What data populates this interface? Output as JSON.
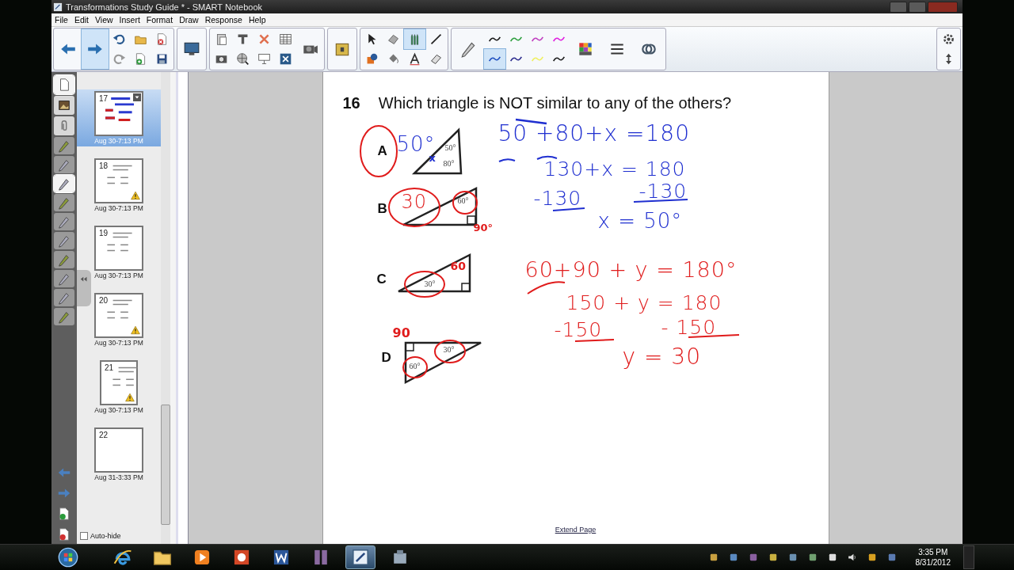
{
  "window": {
    "title": "Transformations Study Guide * - SMART Notebook"
  },
  "menu": [
    "File",
    "Edit",
    "View",
    "Insert",
    "Format",
    "Draw",
    "Response",
    "Help"
  ],
  "toolbar": {
    "groups": [
      {
        "buttons": [
          {
            "kind": "back",
            "selected": false
          },
          {
            "kind": "forward",
            "selected": true
          },
          {
            "kind": "undo",
            "selected": false
          },
          {
            "kind": "redo",
            "selected": false
          },
          {
            "kind": "folder",
            "selected": false
          },
          {
            "kind": "add-page",
            "selected": false
          },
          {
            "kind": "delete-page",
            "selected": false
          },
          {
            "kind": "save",
            "selected": false
          }
        ]
      },
      {
        "buttons": [
          {
            "kind": "monitor",
            "selected": false
          }
        ]
      },
      {
        "buttons": [
          {
            "kind": "clipboard",
            "selected": false
          },
          {
            "kind": "camera",
            "selected": false
          },
          {
            "kind": "shade",
            "selected": false
          },
          {
            "kind": "globe",
            "selected": false
          },
          {
            "kind": "delete",
            "selected": false
          },
          {
            "kind": "screen",
            "selected": false
          },
          {
            "kind": "table",
            "selected": false
          },
          {
            "kind": "xbox",
            "selected": false
          },
          {
            "kind": "projector",
            "selected": false
          }
        ]
      },
      {
        "buttons": [
          {
            "kind": "toolbox",
            "selected": false
          }
        ]
      },
      {
        "buttons": [
          {
            "kind": "select",
            "selected": false
          },
          {
            "kind": "shapes",
            "selected": false
          },
          {
            "kind": "eraser",
            "selected": false
          },
          {
            "kind": "fill",
            "selected": false
          },
          {
            "kind": "pens",
            "selected": true
          },
          {
            "kind": "text",
            "selected": false
          },
          {
            "kind": "line",
            "selected": false
          },
          {
            "kind": "eraser2",
            "selected": false
          }
        ]
      },
      {
        "buttons": [
          {
            "kind": "pen",
            "selected": false
          },
          {
            "kind": "stroke",
            "selected": false
          },
          {
            "kind": "stroke",
            "selected": true
          },
          {
            "kind": "stroke",
            "selected": false
          },
          {
            "kind": "stroke",
            "selected": false
          },
          {
            "kind": "stroke",
            "selected": false
          },
          {
            "kind": "stroke",
            "selected": false
          },
          {
            "kind": "stroke",
            "selected": false
          },
          {
            "kind": "stroke",
            "selected": false
          },
          {
            "kind": "palette",
            "selected": false
          },
          {
            "kind": "lines",
            "selected": false
          },
          {
            "kind": "link",
            "selected": false
          }
        ]
      },
      {
        "buttons": [
          {
            "kind": "gear",
            "selected": false
          },
          {
            "kind": "updown",
            "selected": false
          }
        ]
      }
    ]
  },
  "side_tabs": [
    {
      "kind": "pages",
      "selected": true
    },
    {
      "kind": "gallery",
      "selected": false
    },
    {
      "kind": "attachments",
      "selected": false
    },
    {
      "kind": "tool",
      "selected": false
    },
    {
      "kind": "tool",
      "selected": false
    },
    {
      "kind": "tool",
      "selected": true
    },
    {
      "kind": "tool",
      "selected": false
    },
    {
      "kind": "tool",
      "selected": false
    },
    {
      "kind": "tool",
      "selected": false
    },
    {
      "kind": "tool",
      "selected": false
    },
    {
      "kind": "tool",
      "selected": false
    },
    {
      "kind": "tool",
      "selected": false
    },
    {
      "kind": "tool",
      "selected": false
    }
  ],
  "pages": [
    {
      "number": "17",
      "date": "Aug 30-7:13 PM",
      "selected": true,
      "warning": false
    },
    {
      "number": "18",
      "date": "Aug 30-7:13 PM",
      "selected": false,
      "warning": true
    },
    {
      "number": "19",
      "date": "Aug 30-7:13 PM",
      "selected": false,
      "warning": false
    },
    {
      "number": "20",
      "date": "Aug 30-7:13 PM",
      "selected": false,
      "warning": true
    },
    {
      "number": "21",
      "date": "Aug 30-7:13 PM",
      "selected": false,
      "warning": true
    },
    {
      "number": "22",
      "date": "Aug 31-3:33 PM",
      "selected": false,
      "warning": false
    }
  ],
  "auto_hide": {
    "label": "Auto-hide",
    "checked": false
  },
  "page": {
    "question_number": "16",
    "question": "Which triangle is NOT similar to any of the others?",
    "triangles": [
      {
        "label": "A",
        "angles": [
          "50°",
          "80°"
        ]
      },
      {
        "label": "B",
        "angles": [
          "60°"
        ]
      },
      {
        "label": "C",
        "angles": [
          "30°"
        ]
      },
      {
        "label": "D",
        "angles": [
          "30°",
          "60°"
        ]
      }
    ],
    "ink": [
      {
        "text": "50°",
        "color": "#1f2fd0"
      },
      {
        "text": "x",
        "color": "#1f2fd0"
      },
      {
        "text": "50 +80+x =180",
        "color": "#1f2fd0"
      },
      {
        "text": "130+x = 180",
        "color": "#1f2fd0"
      },
      {
        "text": "-130",
        "color": "#1f2fd0"
      },
      {
        "text": "-130",
        "color": "#1f2fd0"
      },
      {
        "text": "x = 50°",
        "color": "#1f2fd0"
      },
      {
        "text": "30",
        "color": "#e01b1b"
      },
      {
        "text": "90°",
        "color": "#e01b1b"
      },
      {
        "text": "60",
        "color": "#e01b1b"
      },
      {
        "text": "90",
        "color": "#e01b1b"
      },
      {
        "text": "60+90 + y = 180°",
        "color": "#e01b1b"
      },
      {
        "text": "150 + y = 180",
        "color": "#e01b1b"
      },
      {
        "text": "-150",
        "color": "#e01b1b"
      },
      {
        "text": "- 150",
        "color": "#e01b1b"
      },
      {
        "text": "y = 30",
        "color": "#e01b1b"
      }
    ],
    "extend_link": "Extend Page"
  },
  "taskbar": {
    "apps": [
      {
        "kind": "ie",
        "active": false
      },
      {
        "kind": "folder",
        "active": false
      },
      {
        "kind": "media",
        "active": false
      },
      {
        "kind": "powerpoint",
        "active": false
      },
      {
        "kind": "word",
        "active": false
      },
      {
        "kind": "app",
        "active": false
      },
      {
        "kind": "notebook",
        "active": true
      },
      {
        "kind": "tools",
        "active": false
      }
    ],
    "time": "3:35 PM",
    "date": "8/31/2012"
  }
}
